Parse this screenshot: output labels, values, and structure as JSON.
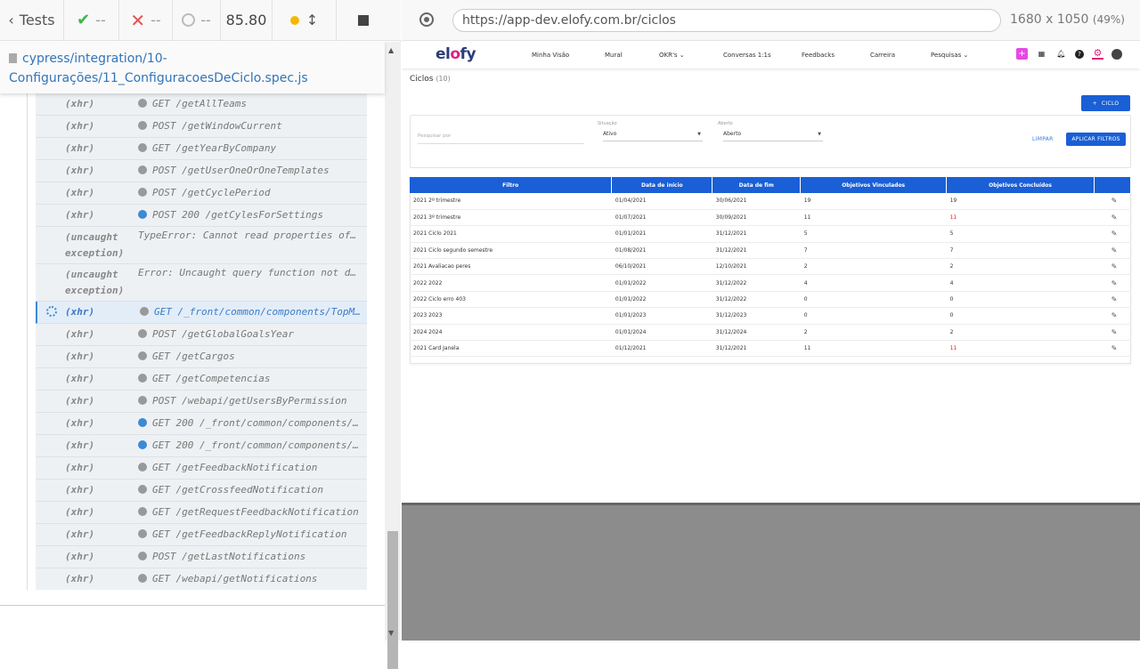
{
  "reporter": {
    "tests_label": "Tests",
    "passed": "--",
    "failed": "--",
    "pending": "--",
    "duration": "85.80",
    "spec_path": "cypress/integration/10-Configurações/11_ConfiguracoesDeCiclo.spec.js",
    "commands": [
      {
        "name": "(xhr)",
        "msg": "GET /getAllTeams",
        "dot": "grey"
      },
      {
        "name": "(xhr)",
        "msg": "POST /getWindowCurrent",
        "dot": "grey"
      },
      {
        "name": "(xhr)",
        "msg": "GET /getYearByCompany",
        "dot": "grey"
      },
      {
        "name": "(xhr)",
        "msg": "POST /getUserOneOrOneTemplates",
        "dot": "grey"
      },
      {
        "name": "(xhr)",
        "msg": "POST /getCyclePeriod",
        "dot": "grey"
      },
      {
        "name": "(xhr)",
        "msg": "POST 200 /getCylesForSettings",
        "dot": "blue"
      },
      {
        "name": "(uncaught exception)",
        "msg": "TypeError: Cannot read properties of undefined",
        "dot": "none"
      },
      {
        "name": "(uncaught exception)",
        "msg": "Error: Uncaught query function not defined",
        "dot": "none"
      },
      {
        "name": "(xhr)",
        "msg": "GET /_front/common/components/TopMenu",
        "dot": "grey",
        "active": true
      },
      {
        "name": "(xhr)",
        "msg": "POST /getGlobalGoalsYear",
        "dot": "grey"
      },
      {
        "name": "(xhr)",
        "msg": "GET /getCargos",
        "dot": "grey"
      },
      {
        "name": "(xhr)",
        "msg": "GET /getCompetencias",
        "dot": "grey"
      },
      {
        "name": "(xhr)",
        "msg": "POST /webapi/getUsersByPermission",
        "dot": "grey"
      },
      {
        "name": "(xhr)",
        "msg": "GET 200 /_front/common/components/...",
        "dot": "blue"
      },
      {
        "name": "(xhr)",
        "msg": "GET 200 /_front/common/components/...",
        "dot": "blue"
      },
      {
        "name": "(xhr)",
        "msg": "GET /getFeedbackNotification",
        "dot": "grey"
      },
      {
        "name": "(xhr)",
        "msg": "GET /getCrossfeedNotification",
        "dot": "grey"
      },
      {
        "name": "(xhr)",
        "msg": "GET /getRequestFeedbackNotification",
        "dot": "grey"
      },
      {
        "name": "(xhr)",
        "msg": "GET /getFeedbackReplyNotification",
        "dot": "grey"
      },
      {
        "name": "(xhr)",
        "msg": "POST /getLastNotifications",
        "dot": "grey"
      },
      {
        "name": "(xhr)",
        "msg": "GET /webapi/getNotifications",
        "dot": "grey"
      }
    ]
  },
  "aut_header": {
    "url": "https://app-dev.elofy.com.br/ciclos",
    "viewport": "1680 x 1050",
    "scale": "(49%)"
  },
  "app": {
    "logo_left": "el",
    "logo_o": "o",
    "logo_right": "fy",
    "nav": [
      "Minha Visão",
      "Mural",
      "OKR's ⌄",
      "Conversas 1:1s",
      "Feedbacks",
      "Carreira",
      "Pesquisas ⌄"
    ],
    "page_title": "Ciclos",
    "page_count": "(10)",
    "new_button": "CICLO",
    "filters": {
      "search_placeholder": "Pesquisar por",
      "situacao_label": "Situação",
      "situacao_value": "Ativo",
      "aberto_label": "Aberto",
      "aberto_value": "Aberto",
      "clear": "LIMPAR",
      "apply": "APLICAR FILTROS"
    },
    "table": {
      "headers": [
        "Filtro",
        "Data de início",
        "Data de fim",
        "Objetivos Vinculados",
        "Objetivos Concluídos",
        ""
      ],
      "rows": [
        {
          "filtro": "2021   2º trimestre",
          "inicio": "01/04/2021",
          "fim": "30/06/2021",
          "vinc": "19",
          "concl": "19",
          "red": false
        },
        {
          "filtro": "2021   3º trimestre",
          "inicio": "01/07/2021",
          "fim": "30/09/2021",
          "vinc": "11",
          "concl": "11",
          "red": true
        },
        {
          "filtro": "2021   Ciclo 2021",
          "inicio": "01/01/2021",
          "fim": "31/12/2021",
          "vinc": "5",
          "concl": "5",
          "red": false
        },
        {
          "filtro": "2021   Ciclo segundo semestre",
          "inicio": "01/08/2021",
          "fim": "31/12/2021",
          "vinc": "7",
          "concl": "7",
          "red": false
        },
        {
          "filtro": "2021   Avaliacao peres",
          "inicio": "06/10/2021",
          "fim": "12/10/2021",
          "vinc": "2",
          "concl": "2",
          "red": false
        },
        {
          "filtro": "2022   2022",
          "inicio": "01/01/2022",
          "fim": "31/12/2022",
          "vinc": "4",
          "concl": "4",
          "red": false
        },
        {
          "filtro": "2022   Ciclo erro 403",
          "inicio": "01/01/2022",
          "fim": "31/12/2022",
          "vinc": "0",
          "concl": "0",
          "red": false
        },
        {
          "filtro": "2023   2023",
          "inicio": "01/01/2023",
          "fim": "31/12/2023",
          "vinc": "0",
          "concl": "0",
          "red": false
        },
        {
          "filtro": "2024   2024",
          "inicio": "01/01/2024",
          "fim": "31/12/2024",
          "vinc": "2",
          "concl": "2",
          "red": false
        },
        {
          "filtro": "2021   Card Janela",
          "inicio": "01/12/2021",
          "fim": "31/12/2021",
          "vinc": "11",
          "concl": "11",
          "red": true
        }
      ]
    }
  },
  "colors": {
    "primary_blue": "#1a5fd6",
    "brand_pink": "#e0207f",
    "pass_green": "#3bb54a",
    "fail_red": "#e94f4f"
  }
}
